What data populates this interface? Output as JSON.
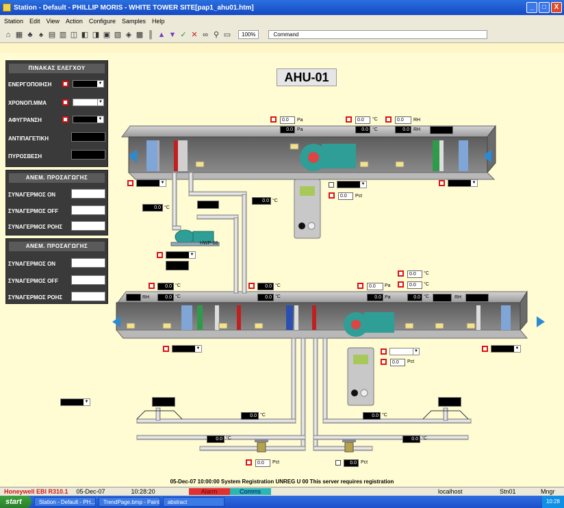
{
  "window": {
    "title": "Station - Default - PHILLIP MORIS - WHITE TOWER SITE[pap1_ahu01.htm]",
    "buttons": [
      "_",
      "□",
      "X"
    ]
  },
  "menu": [
    "Station",
    "Edit",
    "View",
    "Action",
    "Configure",
    "Samples",
    "Help"
  ],
  "toolbar": {
    "zoom": "100%",
    "command_label": "Command"
  },
  "ahu_title": "AHU-01",
  "control_panel": {
    "header": "ΠΙΝΑΚΑΣ ΕΛΕΓΧΟΥ",
    "rows": [
      "ΕΝΕΡΓΟΠΟΙΗΣΗ",
      "ΧΡΟΝΟΠ.ΜΜΑ",
      "ΑΦΥΓΡΑΝΣΗ",
      "ΑΝΤΙΠΑΓΕΤΙΚΗ",
      "ΠΥΡΟΣΒΕΣΗ"
    ]
  },
  "supply_panel": {
    "header": "ΑΝΕΜ. ΠΡΟΣΑΓΩΓΗΣ",
    "rows": [
      "ΣΥΝΑΓΕΡΜΟΣ ON",
      "ΣΥΝΑΓΕΡΜΟΣ OFF",
      "ΣΥΝΑΓΕΡΜΟΣ ΡΟΗΣ"
    ]
  },
  "return_panel": {
    "header": "ΑΝΕΜ. ΠΡΟΣΑΓΩΓΗΣ",
    "rows": [
      "ΣΥΝΑΓΕΡΜΟΣ ON",
      "ΣΥΝΑΓΕΡΜΟΣ OFF",
      "ΣΥΝΑΓΕΡΜΟΣ ΡΟΗΣ"
    ]
  },
  "units": {
    "pa": "Pa",
    "c": "°C",
    "rh": "RH",
    "pct": "Pct"
  },
  "values": {
    "zero": "0.0"
  },
  "pump_label": "HWP-08",
  "status_message": "05-Dec-07  10:00:00  System  Registration  UNREG  U 00 This server requires registration",
  "statusbar": {
    "product": "Honeywell EBI R310.1",
    "date": "05-Dec-07",
    "time": "10:28:20",
    "alarm": "Alarm",
    "comms": "Comms",
    "host": "localhost",
    "station": "Stn01",
    "user": "Mngr"
  },
  "taskbar": {
    "start": "start",
    "tasks": [
      "Station - Default - PH...",
      "TrendPage.bmp - Paint",
      "abstract"
    ],
    "tray_time": "10:28"
  }
}
